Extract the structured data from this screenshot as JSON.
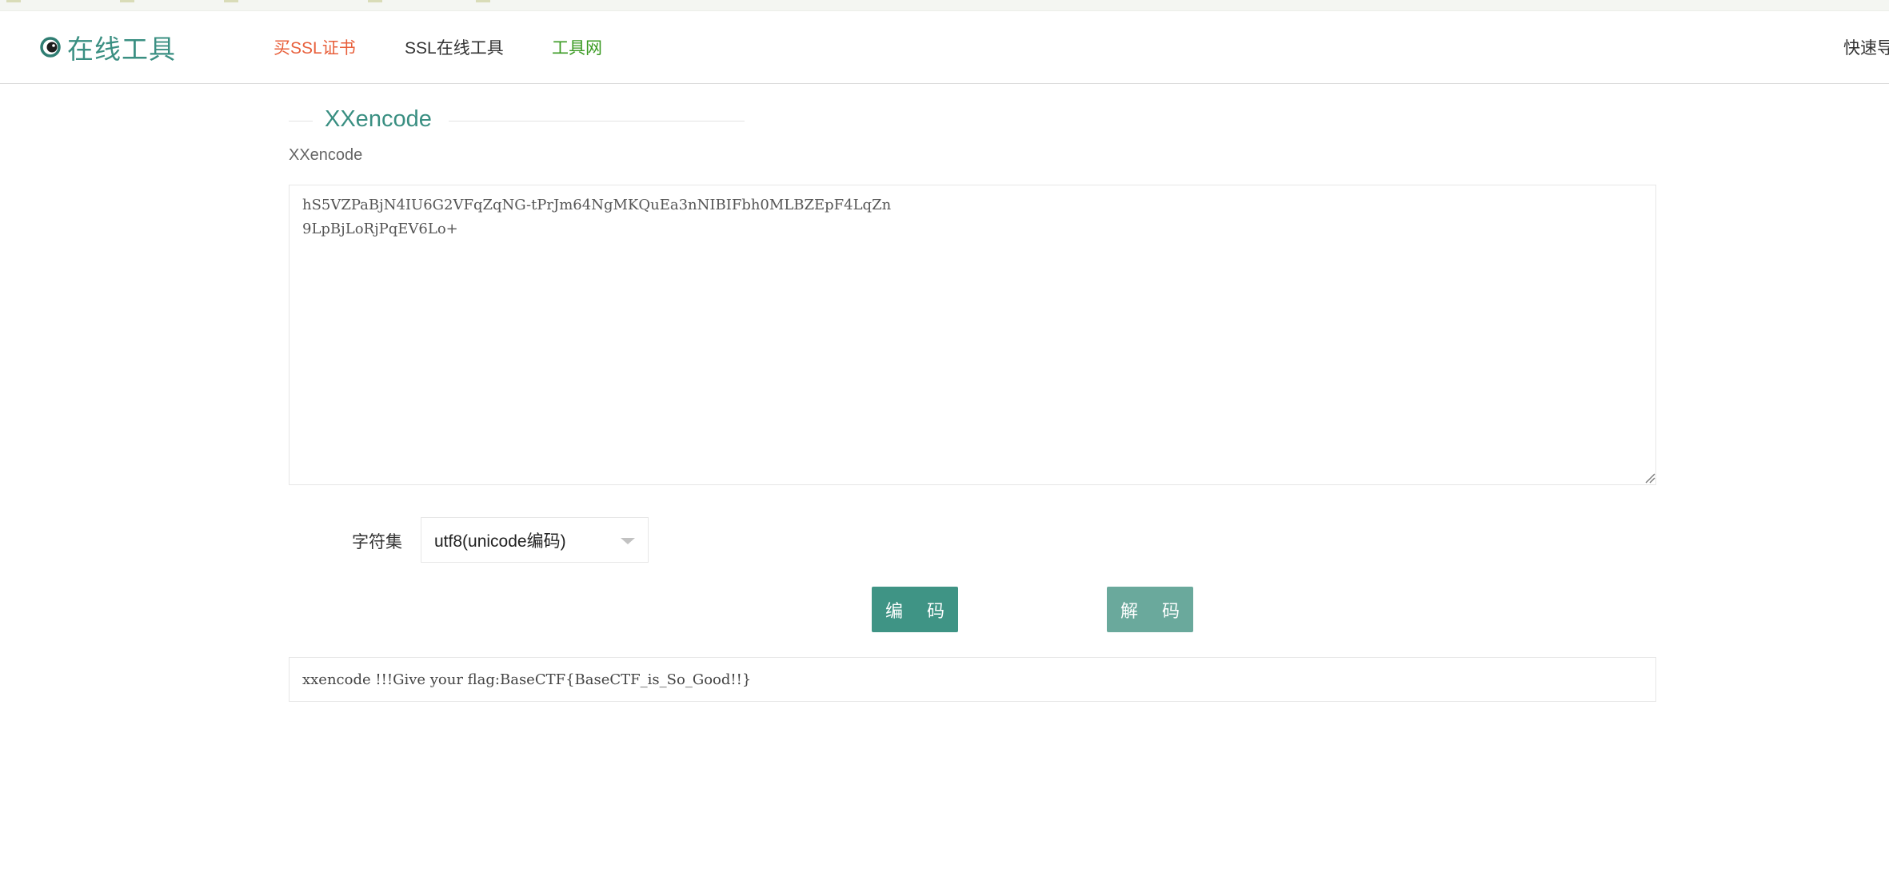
{
  "header": {
    "logo_text": "在线工具",
    "nav": {
      "buy_ssl": "买SSL证书",
      "ssl_tools": "SSL在线工具",
      "tools_net": "工具网",
      "quick_nav": "快速导"
    }
  },
  "main": {
    "section_title": "XXencode",
    "subtitle": "XXencode",
    "input_value": "hS5VZPaBjN4IU6G2VFqZqNG-tPrJm64NgMKQuEa3nNIBIFbh0MLBZEpF4LqZn\n9LpBjLoRjPqEV6Lo+",
    "charset_label": "字符集",
    "charset_selected": "utf8(unicode编码)",
    "encode_button": "编 码",
    "decode_button": "解 码",
    "output_value": "xxencode !!!Give your flag:BaseCTF{BaseCTF_is_So_Good!!}"
  },
  "colors": {
    "brand": "#3a8f82",
    "buy_ssl": "#e8603c",
    "tools_net": "#3a9a22",
    "encode_button": "#3f9485",
    "decode_button": "#6aa99c"
  }
}
